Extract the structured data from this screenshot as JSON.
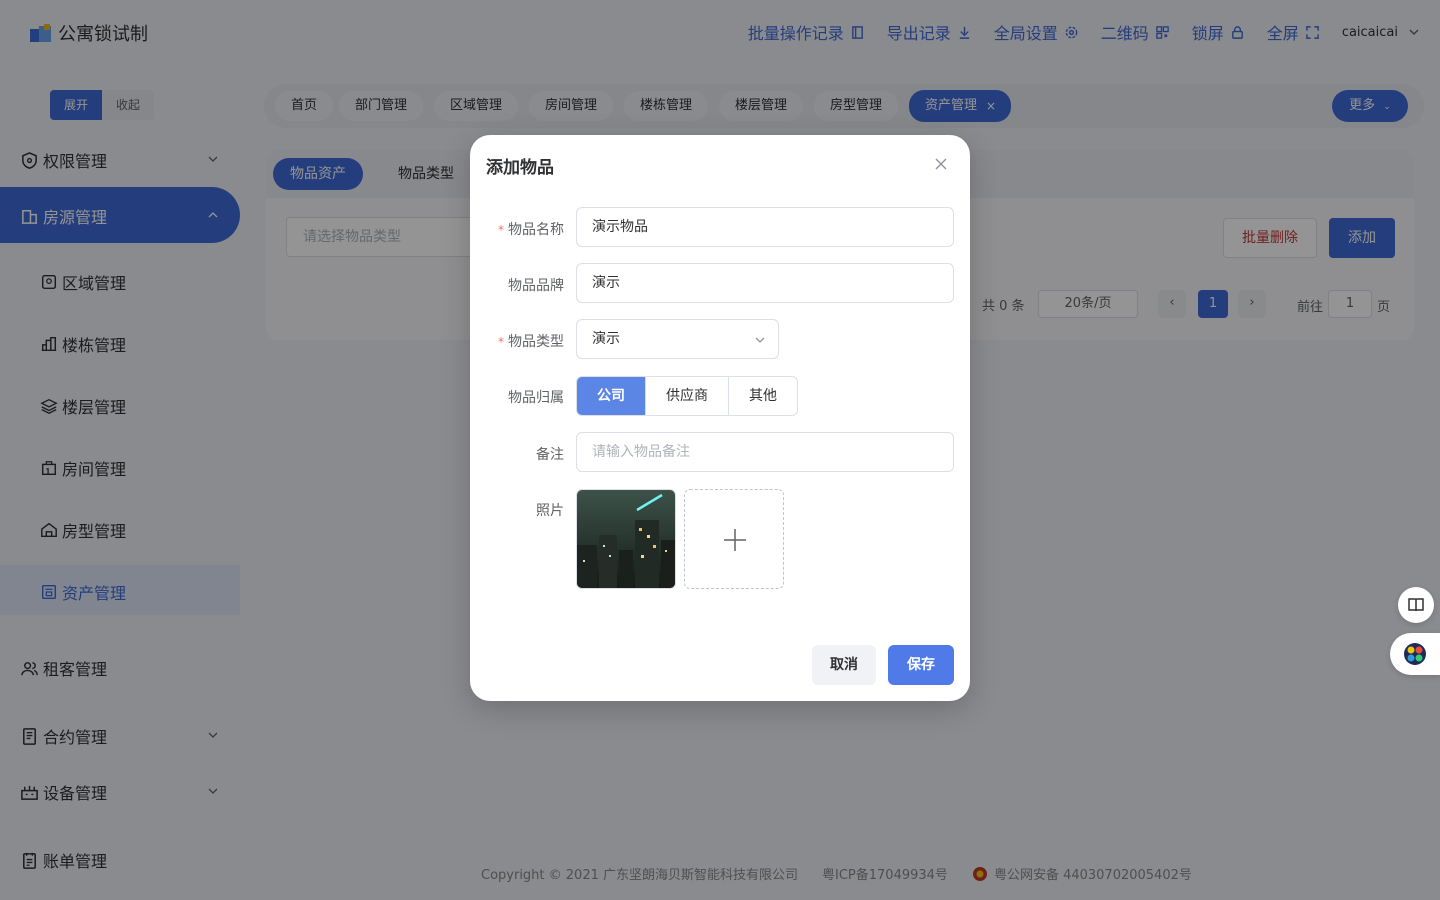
{
  "app": {
    "title": "公寓锁试制"
  },
  "header": {
    "nav": [
      {
        "label": "批量操作记录",
        "icon": "document-icon"
      },
      {
        "label": "导出记录",
        "icon": "download-icon"
      },
      {
        "label": "全局设置",
        "icon": "gear-icon"
      },
      {
        "label": "二维码",
        "icon": "qrcode-icon"
      },
      {
        "label": "锁屏",
        "icon": "lock-icon"
      },
      {
        "label": "全屏",
        "icon": "fullscreen-icon"
      }
    ],
    "user": "caicaicai"
  },
  "sidebar": {
    "toggle": {
      "expand": "展开",
      "collapse": "收起"
    },
    "items": [
      {
        "label": "权限管理",
        "icon": "shield-icon"
      },
      {
        "label": "房源管理",
        "icon": "house-icon"
      },
      {
        "label": "租客管理",
        "icon": "users-icon"
      },
      {
        "label": "合约管理",
        "icon": "contract-icon"
      },
      {
        "label": "设备管理",
        "icon": "device-icon"
      },
      {
        "label": "账单管理",
        "icon": "bill-icon"
      }
    ],
    "sub_items": [
      {
        "label": "区域管理",
        "icon": "region-icon"
      },
      {
        "label": "楼栋管理",
        "icon": "building-icon"
      },
      {
        "label": "楼层管理",
        "icon": "layers-icon"
      },
      {
        "label": "房间管理",
        "icon": "room-icon"
      },
      {
        "label": "房型管理",
        "icon": "home-type-icon"
      },
      {
        "label": "资产管理",
        "icon": "asset-icon"
      }
    ]
  },
  "tags": [
    "首页",
    "部门管理",
    "区域管理",
    "房间管理",
    "楼栋管理",
    "楼层管理",
    "房型管理",
    "资产管理"
  ],
  "tags_more": "更多",
  "main": {
    "sub_tabs": [
      "物品资产",
      "物品类型"
    ],
    "type_select_placeholder": "请选择物品类型",
    "batch_delete": "批量删除",
    "add": "添加",
    "pager": {
      "total": "共 0 条",
      "page_size": "20条/页",
      "current": "1",
      "goto_label": "前往",
      "goto_value": "1",
      "page_suffix": "页"
    }
  },
  "dialog": {
    "title": "添加物品",
    "fields": {
      "name": {
        "label": "物品名称",
        "value": "演示物品",
        "required": true
      },
      "brand": {
        "label": "物品品牌",
        "value": "演示"
      },
      "type": {
        "label": "物品类型",
        "value": "演示",
        "required": true
      },
      "owner": {
        "label": "物品归属",
        "options": [
          "公司",
          "供应商",
          "其他"
        ],
        "selected": "公司"
      },
      "remark": {
        "label": "备注",
        "placeholder": "请输入物品备注"
      },
      "photo": {
        "label": "照片"
      }
    },
    "cancel": "取消",
    "save": "保存"
  },
  "footer": {
    "copyright": "Copyright © 2021 广东坚朗海贝斯智能科技有限公司",
    "icp": "粤ICP备17049934号",
    "police": "粤公网安备 44030702005402号"
  },
  "colors": {
    "accent": "#3f6ad8",
    "danger": "#c23a3a",
    "required": "#f56c6c"
  }
}
